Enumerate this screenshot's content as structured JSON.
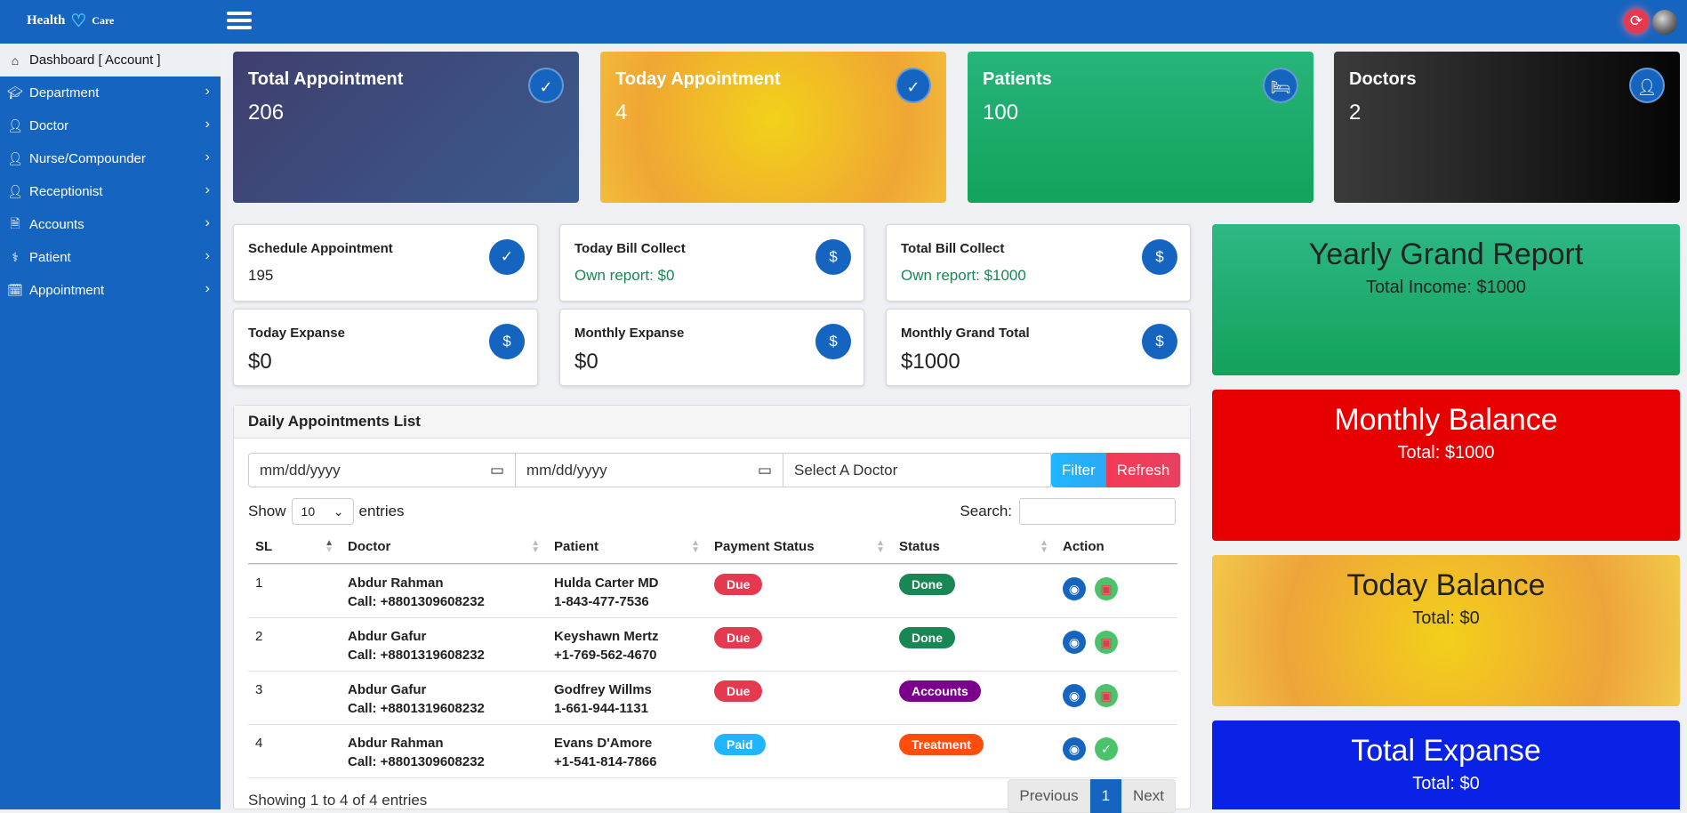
{
  "header": {
    "logo_left": "Health",
    "logo_right": "Care",
    "logo_icon": "heart-plus-icon",
    "menu_icon": "hamburger-icon",
    "refresh_icon": "refresh-icon"
  },
  "sidebar": {
    "items": [
      {
        "label": "Dashboard [ Account ]",
        "icon": "home-icon"
      },
      {
        "label": "Department",
        "icon": "graduation-cap-icon"
      },
      {
        "label": "Doctor",
        "icon": "user-md-icon"
      },
      {
        "label": "Nurse/Compounder",
        "icon": "user-nurse-icon"
      },
      {
        "label": "Receptionist",
        "icon": "user-icon"
      },
      {
        "label": "Accounts",
        "icon": "file-invoice-icon"
      },
      {
        "label": "Patient",
        "icon": "patient-icon"
      },
      {
        "label": "Appointment",
        "icon": "calendar-check-icon"
      }
    ]
  },
  "stats": [
    {
      "title": "Total Appointment",
      "value": "206",
      "icon": "calendar-check-icon"
    },
    {
      "title": "Today Appointment",
      "value": "4",
      "icon": "calendar-check-icon"
    },
    {
      "title": "Patients",
      "value": "100",
      "icon": "hospital-bed-icon"
    },
    {
      "title": "Doctors",
      "value": "2",
      "icon": "user-md-icon"
    }
  ],
  "small_cards": [
    {
      "title": "Schedule Appointment",
      "value": "195",
      "icon": "calendar-check-icon"
    },
    {
      "title": "Today Bill Collect",
      "value": "Own report: $0",
      "icon": "invoice-dollar-icon"
    },
    {
      "title": "Total Bill Collect",
      "value": "Own report: $1000",
      "icon": "invoice-dollar-icon"
    },
    {
      "title": "Today Expanse",
      "value": "$0",
      "icon": "invoice-dollar-icon"
    },
    {
      "title": "Monthly Expanse",
      "value": "$0",
      "icon": "invoice-dollar-icon"
    },
    {
      "title": "Monthly Grand Total",
      "value": "$1000",
      "icon": "invoice-dollar-icon"
    }
  ],
  "reports": [
    {
      "title": "Yearly Grand Report",
      "sub": "Total Income: $1000",
      "color": "#1fa971"
    },
    {
      "title": "Monthly Balance",
      "sub": "Total: $1000",
      "color": "#e50000"
    },
    {
      "title": "Today Balance",
      "sub": "Total: $0",
      "color": "#f2c12e"
    },
    {
      "title": "Total Expanse",
      "sub": "Total: $0",
      "color": "#0a22e6"
    }
  ],
  "appointments": {
    "title": "Daily Appointments List",
    "date_from_placeholder": "mm/dd/yyyy",
    "date_to_placeholder": "mm/dd/yyyy",
    "doctor_select": "Select A Doctor",
    "filter_label": "Filter",
    "refresh_label": "Refresh",
    "show_label": "Show",
    "entries_value": "10",
    "entries_label": "entries",
    "search_label": "Search:",
    "columns": [
      "SL",
      "Doctor",
      "Patient",
      "Payment Status",
      "Status",
      "Action"
    ],
    "rows": [
      {
        "sl": "1",
        "doctor": "Abdur Rahman",
        "doctor_call": "Call: +8801309608232",
        "patient": "Hulda Carter MD",
        "patient_phone": "1-843-477-7536",
        "payment": "Due",
        "status": "Done"
      },
      {
        "sl": "2",
        "doctor": "Abdur Gafur",
        "doctor_call": "Call: +8801319608232",
        "patient": "Keyshawn Mertz",
        "patient_phone": "+1-769-562-4670",
        "payment": "Due",
        "status": "Done"
      },
      {
        "sl": "3",
        "doctor": "Abdur Gafur",
        "doctor_call": "Call: +8801319608232",
        "patient": "Godfrey Willms",
        "patient_phone": "1-661-944-1131",
        "payment": "Due",
        "status": "Accounts"
      },
      {
        "sl": "4",
        "doctor": "Abdur Rahman",
        "doctor_call": "Call: +8801309608232",
        "patient": "Evans D'Amore",
        "patient_phone": "+1-541-814-7866",
        "payment": "Paid",
        "status": "Treatment"
      }
    ],
    "footer": "Showing 1 to 4 of 4 entries",
    "prev_label": "Previous",
    "page": "1",
    "next_label": "Next"
  },
  "colors": {
    "primary": "#1565c0",
    "due": "#e53950",
    "paid": "#1fb6ff",
    "done": "#198754",
    "accounts": "#7b008b",
    "treatment": "#ff4d0d"
  }
}
